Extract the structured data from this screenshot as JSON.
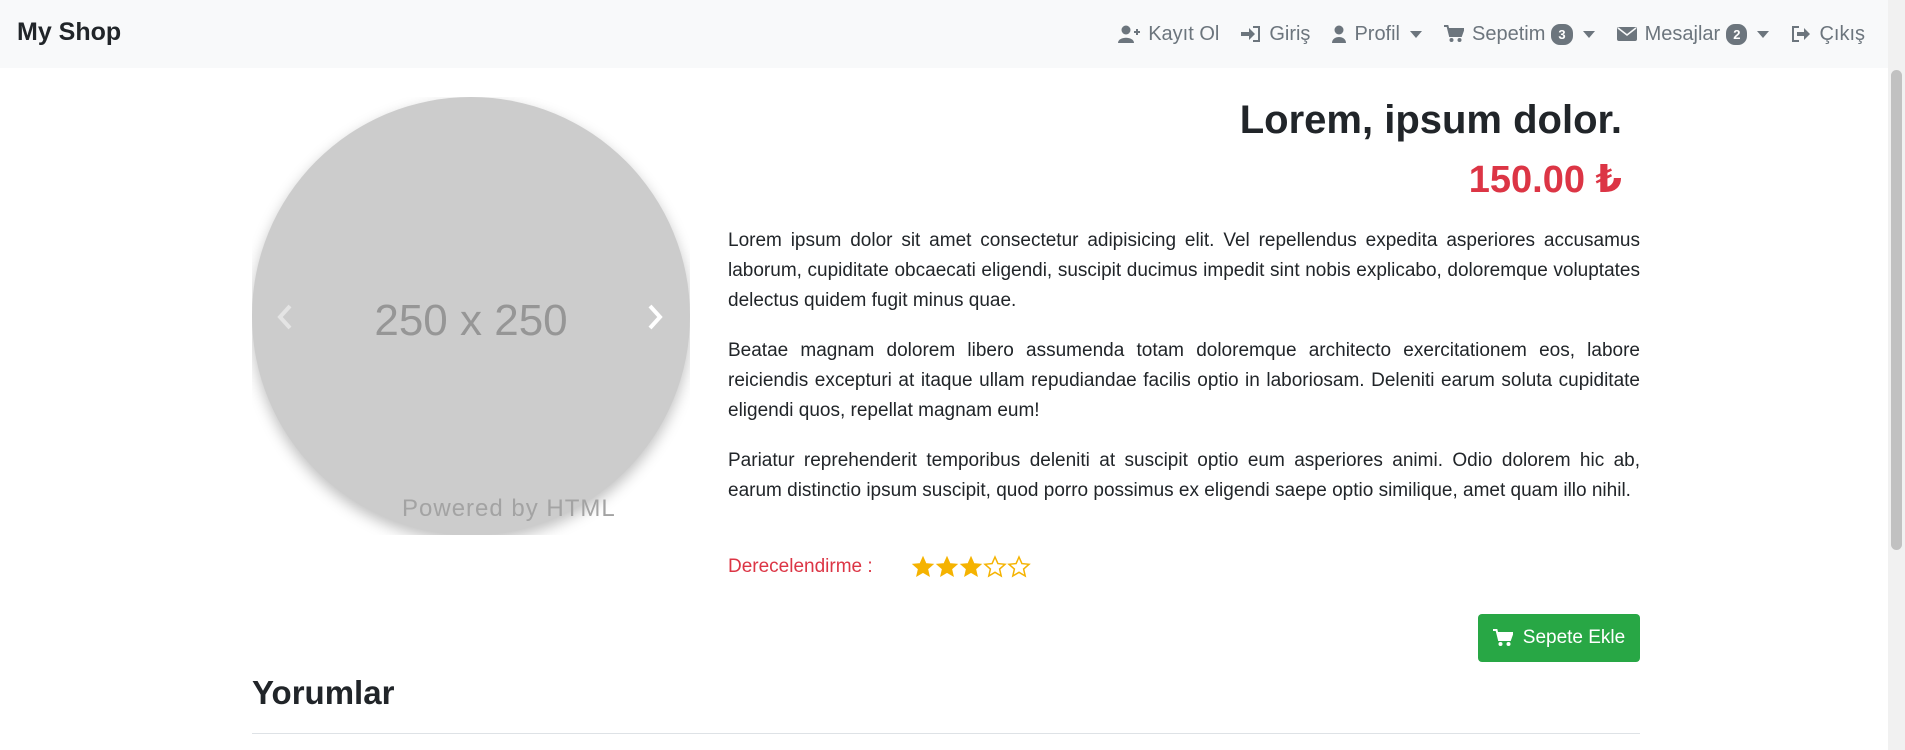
{
  "brand": "My Shop",
  "nav": {
    "register": "Kayıt Ol",
    "login": "Giriş",
    "profile": "Profil",
    "cart": "Sepetim",
    "cart_count": "3",
    "messages": "Mesajlar",
    "messages_count": "2",
    "logout": "Çıkış"
  },
  "carousel": {
    "placeholder": "250 x 250",
    "powered": "Powered by HTML"
  },
  "product": {
    "title": "Lorem, ipsum dolor.",
    "price": "150.00 ₺",
    "paragraphs": [
      "Lorem ipsum dolor sit amet consectetur adipisicing elit. Vel repellendus expedita asperiores accusamus laborum, cupiditate obcaecati eligendi, suscipit ducimus impedit sint nobis explicabo, doloremque voluptates delectus quidem fugit minus quae.",
      "Beatae magnam dolorem libero assumenda totam doloremque architecto exercitationem eos, labore reiciendis excepturi at itaque ullam repudiandae facilis optio in laboriosam. Deleniti earum soluta cupiditate eligendi quos, repellat magnam eum!",
      "Pariatur reprehenderit temporibus deleniti at suscipit optio eum asperiores animi. Odio dolorem hic ab, earum distinctio ipsum suscipit, quod porro possimus ex eligendi saepe optio similique, amet quam illo nihil."
    ],
    "rating_label": "Derecelendirme :",
    "rating_value": 3,
    "rating_max": 5,
    "add_to_cart": "Sepete Ekle"
  },
  "reviews": {
    "title": "Yorumlar"
  },
  "colors": {
    "price": "#dc3545",
    "star": "#f5b301",
    "button": "#28a745",
    "navbar_bg": "#f8f9fa"
  }
}
